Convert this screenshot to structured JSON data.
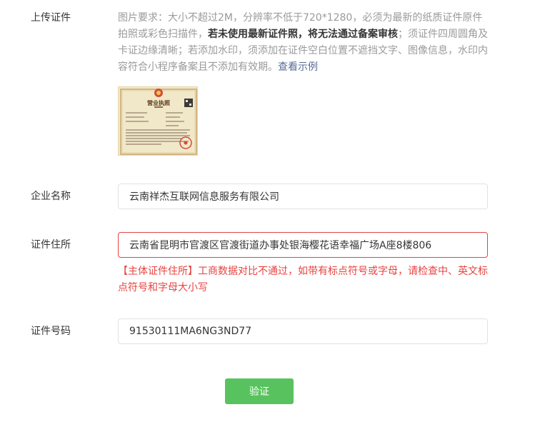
{
  "upload": {
    "label": "上传证件",
    "hint_part1": "图片要求：大小不超过2M，分辨率不低于720*1280，必须为最新的纸质证件原件拍照或彩色扫描件，",
    "hint_bold": "若未使用最新证件照，将无法通过备案审核",
    "hint_part2": "；须证件四周圆角及卡证边缘清晰；若添加水印，须添加在证件空白位置不遮挡文字、图像信息，水印内容符合小程序备案且不添加有效期。",
    "example_link": "查看示例",
    "license_title": "营业执照"
  },
  "company_name": {
    "label": "企业名称",
    "value": "云南祥杰互联网信息服务有限公司"
  },
  "address": {
    "label": "证件住所",
    "value": "云南省昆明市官渡区官渡街道办事处银海樱花语幸福广场A座8楼806",
    "error": "【主体证件住所】工商数据对比不通过，如带有标点符号或字母，请检查中、英文标点符号和字母大小写"
  },
  "cert_number": {
    "label": "证件号码",
    "value": "91530111MA6NG3ND77"
  },
  "verify_button": "验证",
  "colors": {
    "primary": "#58c35e",
    "error": "#e64340",
    "link": "#576b95"
  }
}
